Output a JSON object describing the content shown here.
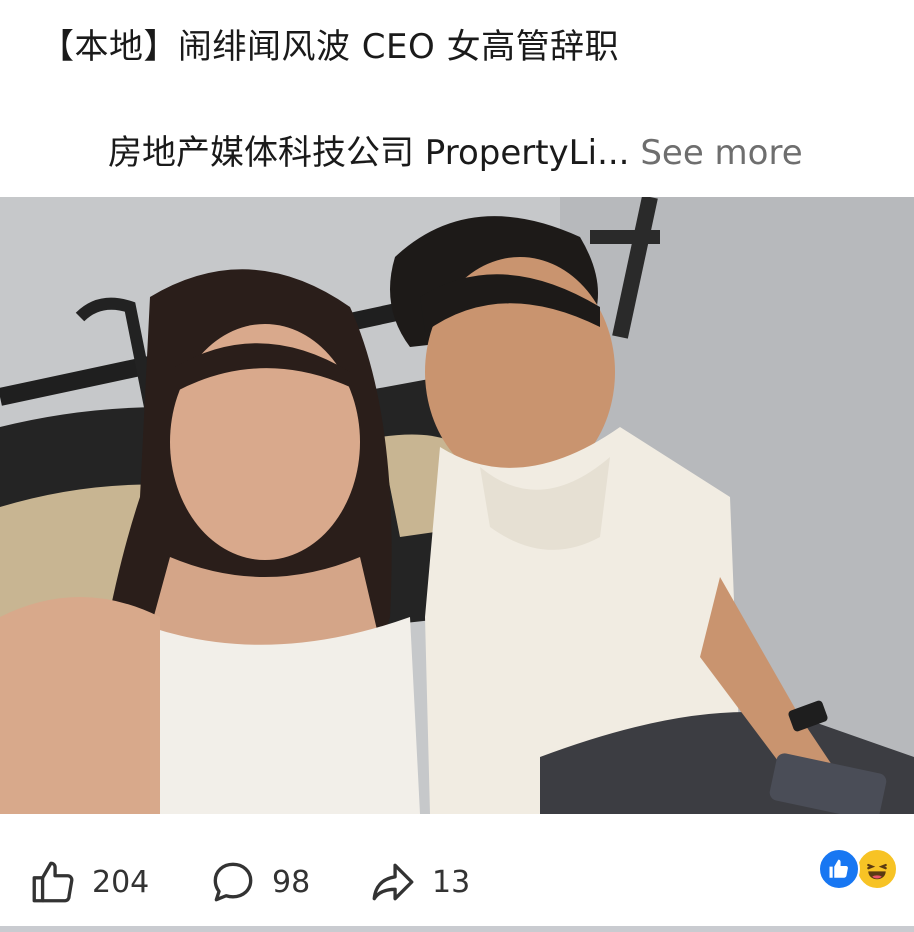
{
  "post": {
    "title": "【本地】闹绯闻风波  CEO 女高管辞职",
    "excerpt": "房地产媒体科技公司 PropertyLi...",
    "see_more_label": "See more"
  },
  "actions": {
    "like_count": "204",
    "comment_count": "98",
    "share_count": "13"
  },
  "icons": {
    "like": "thumbs-up-icon",
    "comment": "comment-bubble-icon",
    "share": "share-arrow-icon",
    "reaction_like": "like-reaction-icon",
    "reaction_haha": "haha-reaction-icon"
  },
  "colors": {
    "facebook_blue": "#1877f2",
    "haha_yellow": "#f7c325",
    "see_more_gray": "#6e6e6e"
  }
}
